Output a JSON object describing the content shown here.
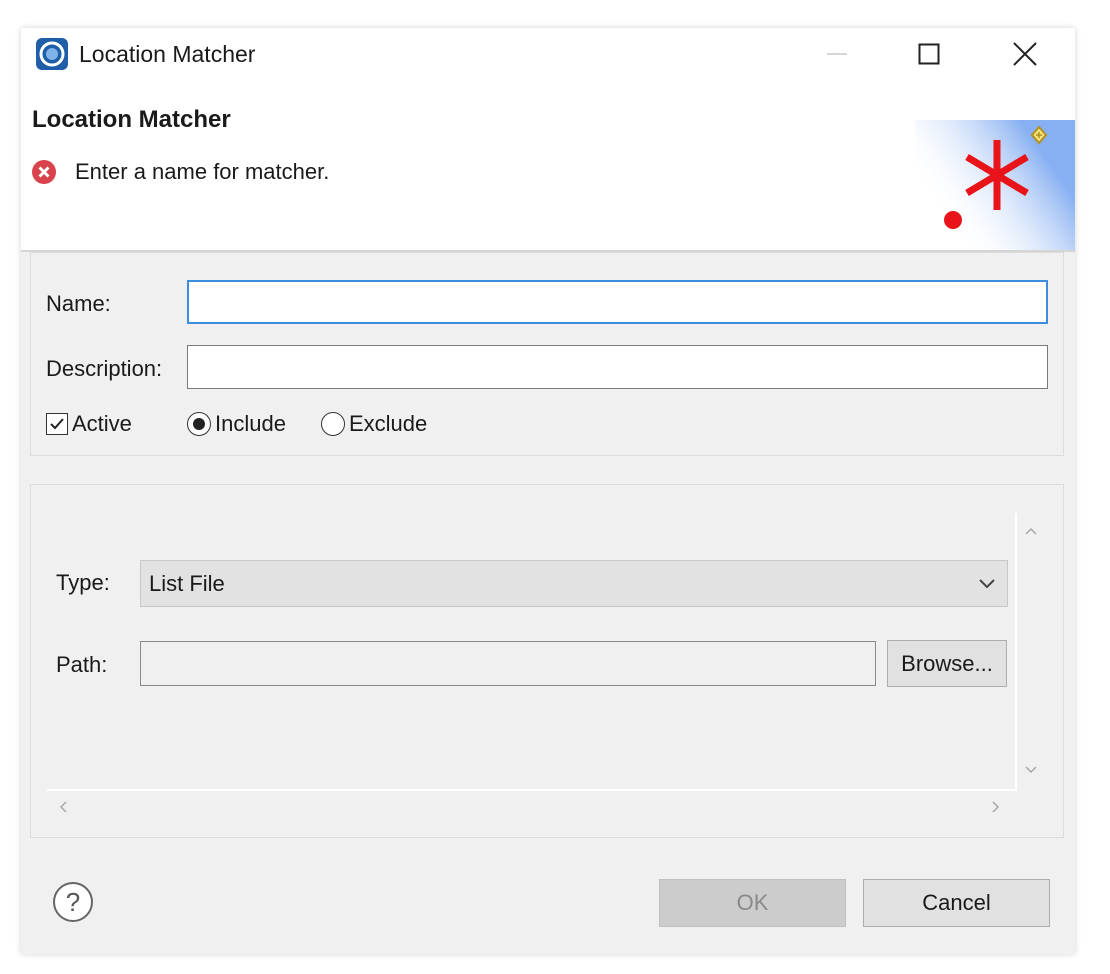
{
  "window": {
    "title": "Location Matcher",
    "minimize_label": "—",
    "maximize_label": "☐",
    "close_label": "✕"
  },
  "header": {
    "title": "Location Matcher",
    "message": "Enter a name for matcher.",
    "message_icon": "error-icon"
  },
  "general": {
    "name_label": "Name:",
    "name_value": "",
    "description_label": "Description:",
    "description_value": "",
    "active_label": "Active",
    "active_checked": true,
    "include_label": "Include",
    "exclude_label": "Exclude",
    "selected_mode": "Include"
  },
  "matcher": {
    "type_label": "Type:",
    "type_value": "List File",
    "path_label": "Path:",
    "path_value": "",
    "browse_label": "Browse..."
  },
  "buttons": {
    "ok_label": "OK",
    "ok_enabled": false,
    "cancel_label": "Cancel"
  },
  "colors": {
    "focus_border": "#3c8edc",
    "error_red": "#d9434e",
    "wizard_star_red": "#e8141a"
  }
}
